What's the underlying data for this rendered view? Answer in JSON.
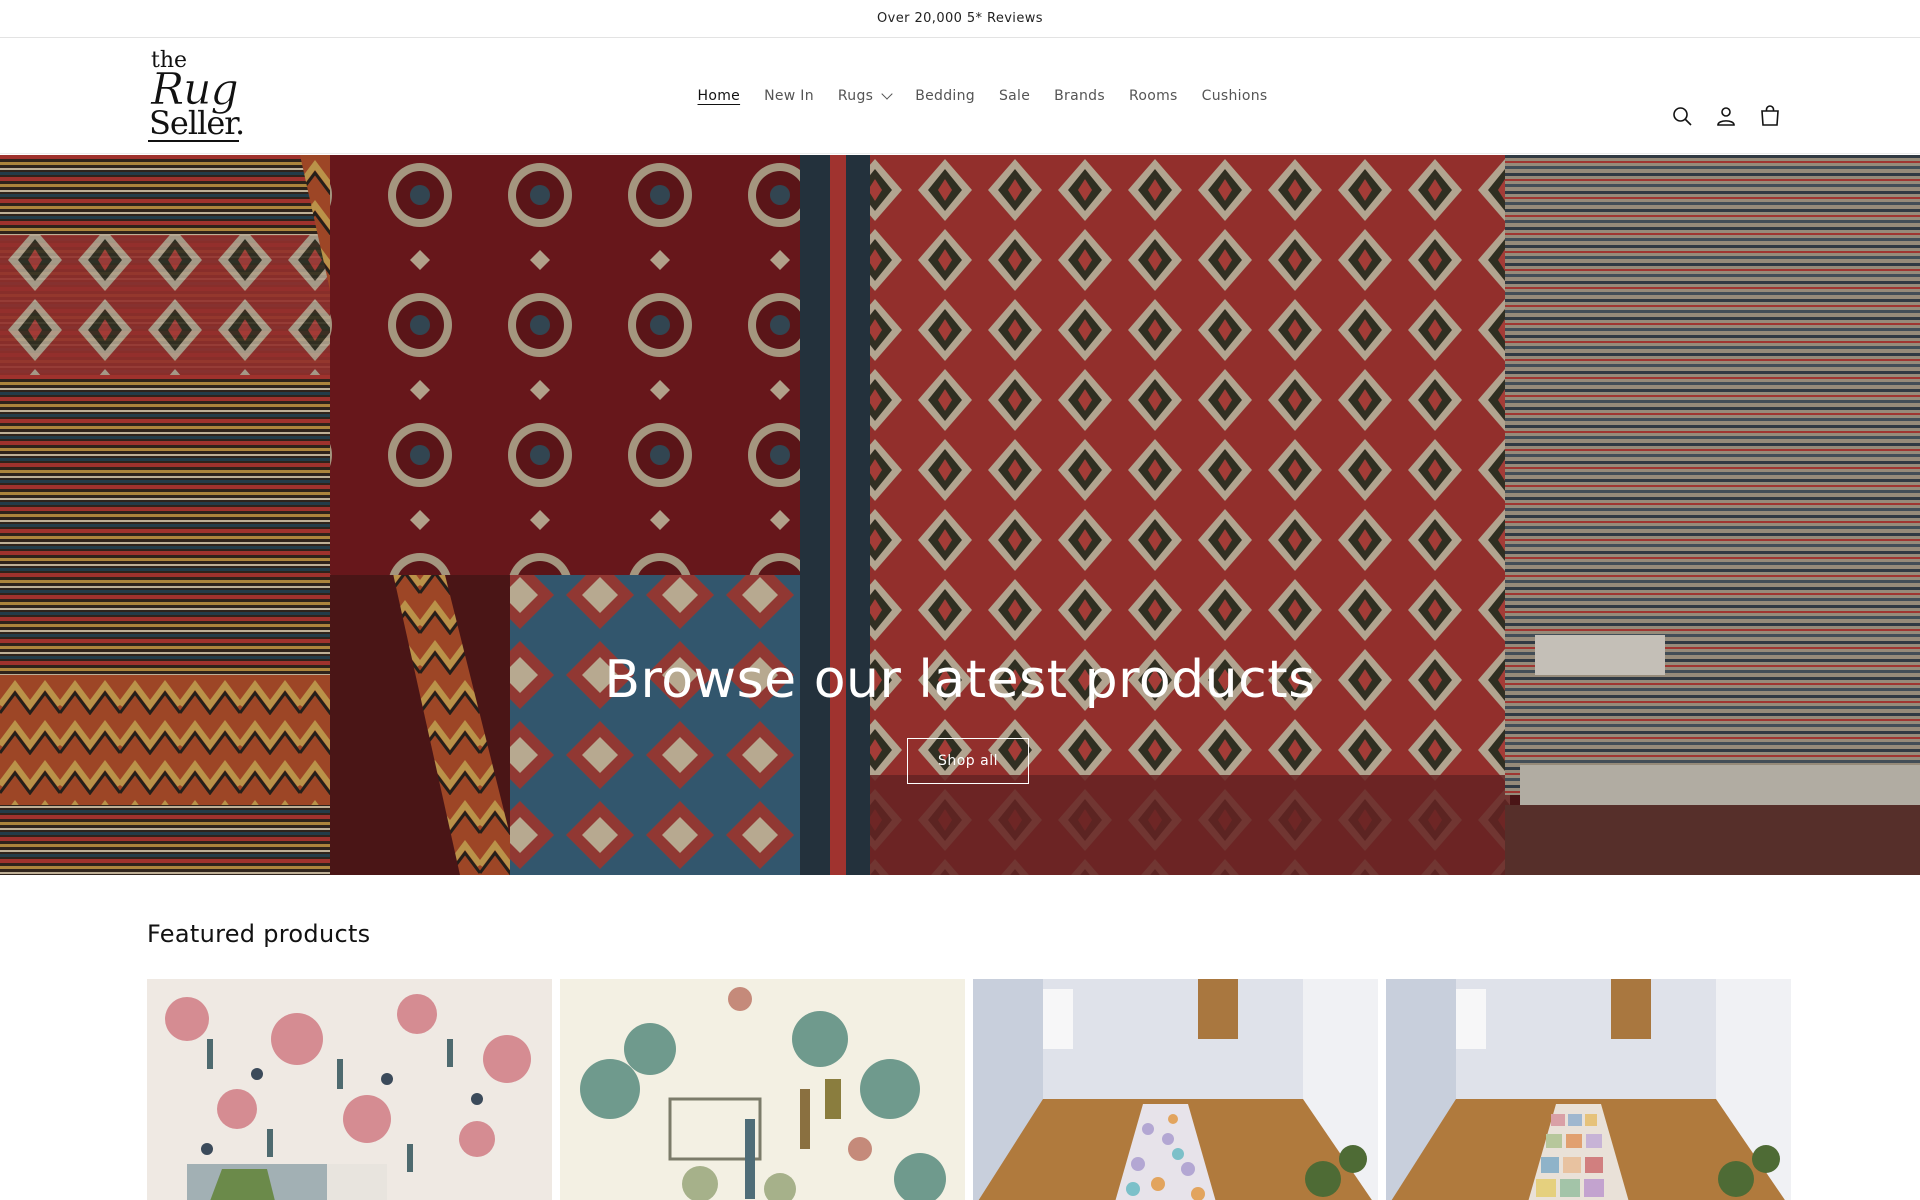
{
  "announcement": {
    "text": "Over 20,000 5* Reviews"
  },
  "brand": {
    "logo_the": "the",
    "logo_rug": "Rug",
    "logo_seller": "Seller."
  },
  "nav": {
    "items": [
      {
        "label": "Home",
        "active": true
      },
      {
        "label": "New In"
      },
      {
        "label": "Rugs",
        "has_dropdown": true
      },
      {
        "label": "Bedding"
      },
      {
        "label": "Sale"
      },
      {
        "label": "Brands"
      },
      {
        "label": "Rooms"
      },
      {
        "label": "Cushions"
      }
    ]
  },
  "header_icons": [
    "search-icon",
    "account-icon",
    "cart-icon"
  ],
  "hero": {
    "title": "Browse our latest products",
    "button_label": "Shop all"
  },
  "featured": {
    "title": "Featured products",
    "products": [
      {
        "image": "pastoral-toile-wallpaper-pink"
      },
      {
        "image": "pastoral-toile-fabric-green"
      },
      {
        "image": "hallway-runner-rug-multicolour-trellis"
      },
      {
        "image": "hallway-runner-rug-patchwork"
      }
    ]
  },
  "colors": {
    "text": "#121212",
    "muted": "#555555",
    "hero_red": "#8a1f22"
  }
}
